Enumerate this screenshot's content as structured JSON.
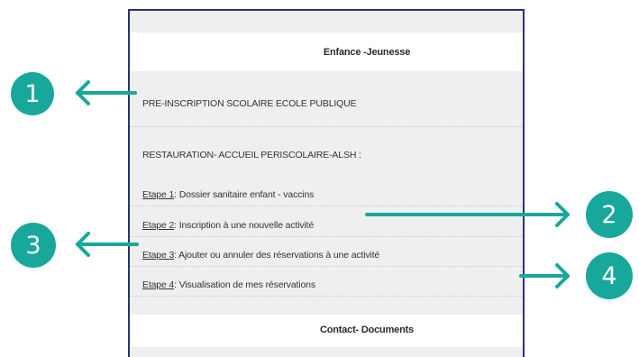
{
  "sections": {
    "enfance_title": "Enfance -Jeunesse",
    "contact_title": "Contact- Documents"
  },
  "items": {
    "preinscription": "PRE-INSCRIPTION SCOLAIRE ECOLE PUBLIQUE",
    "restauration": "RESTAURATION- ACCUEIL PERISCOLAIRE-ALSH :",
    "etapes": [
      {
        "link": "Etape 1",
        "sep": ": ",
        "text": "Dossier sanitaire enfant - vaccins"
      },
      {
        "link": "Etape 2",
        "sep": ": ",
        "text": "Inscription à une nouvelle activité"
      },
      {
        "link": "Etape 3",
        "sep": ": ",
        "text": "Ajouter ou annuler des réservations à une activité"
      },
      {
        "link": "Etape 4",
        "sep": ": ",
        "text": "Visualisation de mes réservations"
      }
    ]
  },
  "callouts": [
    "1",
    "2",
    "3",
    "4"
  ],
  "colors": {
    "accent": "#17a89b",
    "frame": "#2a3472",
    "band": "#efefef"
  }
}
